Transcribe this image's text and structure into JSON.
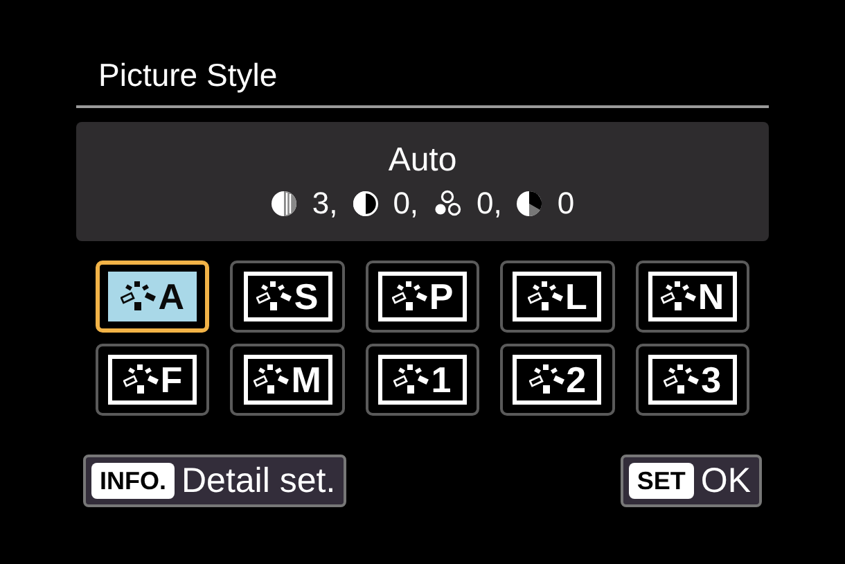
{
  "title": "Picture Style",
  "current": {
    "name": "Auto",
    "params": [
      {
        "kind": "sharpness",
        "value": "3,"
      },
      {
        "kind": "contrast",
        "value": "0,"
      },
      {
        "kind": "saturation",
        "value": "0,"
      },
      {
        "kind": "tone",
        "value": "0"
      }
    ]
  },
  "styles": [
    {
      "letter": "A",
      "selected": true
    },
    {
      "letter": "S",
      "selected": false
    },
    {
      "letter": "P",
      "selected": false
    },
    {
      "letter": "L",
      "selected": false
    },
    {
      "letter": "N",
      "selected": false
    },
    {
      "letter": "F",
      "selected": false
    },
    {
      "letter": "M",
      "selected": false
    },
    {
      "letter": "1",
      "selected": false
    },
    {
      "letter": "2",
      "selected": false
    },
    {
      "letter": "3",
      "selected": false
    }
  ],
  "buttons": [
    {
      "key": "INFO.",
      "label": "Detail set."
    },
    {
      "key": "SET",
      "label": "OK"
    }
  ]
}
